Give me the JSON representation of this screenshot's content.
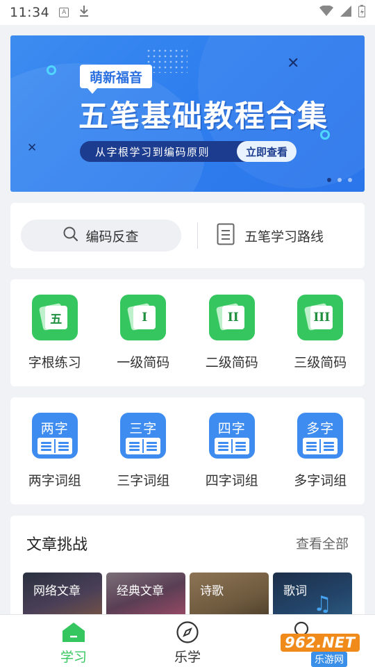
{
  "status_bar": {
    "time": "11:34",
    "a_label": "A"
  },
  "banner": {
    "tag": "萌新福音",
    "headline": "五笔基础教程合集",
    "subline": "从字根学习到编码原则",
    "cta": "立即查看"
  },
  "tools": {
    "search_label": "编码反查",
    "route_label": "五笔学习路线"
  },
  "practice": [
    {
      "glyph": "五",
      "label": "字根练习"
    },
    {
      "glyph": "I",
      "label": "一级简码"
    },
    {
      "glyph": "II",
      "label": "二级简码"
    },
    {
      "glyph": "III",
      "label": "三级简码"
    }
  ],
  "phrases": [
    {
      "word": "两字",
      "label": "两字词组"
    },
    {
      "word": "三字",
      "label": "三字词组"
    },
    {
      "word": "四字",
      "label": "四字词组"
    },
    {
      "word": "多字",
      "label": "多字词组"
    }
  ],
  "articles": {
    "title": "文章挑战",
    "more": "查看全部",
    "items": [
      "网络文章",
      "经典文章",
      "诗歌",
      "歌词"
    ]
  },
  "tabbar": {
    "tabs": [
      "学习",
      "乐学"
    ]
  },
  "watermark": {
    "brand": "962.NET",
    "site": "乐游网"
  },
  "colors": {
    "accent_green": "#36c65f",
    "accent_blue": "#3f8cf0",
    "banner_blue": "#2f7fef"
  }
}
